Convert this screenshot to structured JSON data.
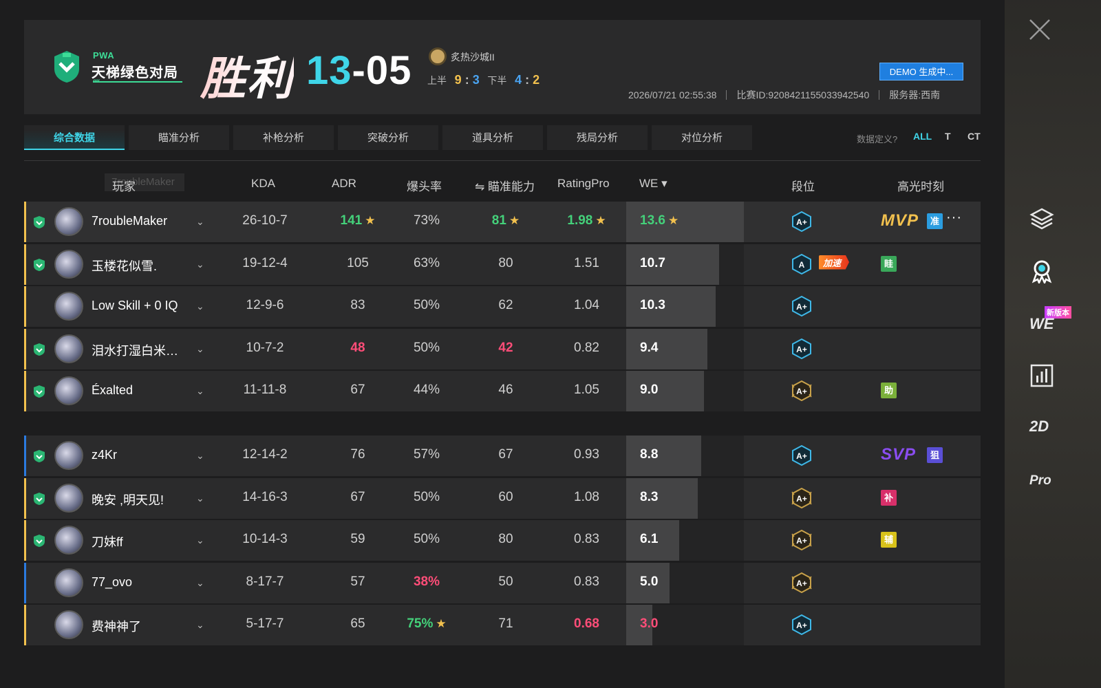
{
  "header": {
    "mode_tag": "PWA",
    "mode_title": "天梯绿色对局",
    "result": "胜利",
    "score_team": "13",
    "score_sep": "-",
    "score_enemy": "05",
    "map": "炙热沙城II",
    "first_half_label": "上半",
    "first_half_a": "9",
    "first_half_b": "3",
    "second_half_label": "下半",
    "second_half_a": "4",
    "second_half_b": "2",
    "half_sep": ":",
    "demo_button": "DEMO 生成中...",
    "datetime": "2026/07/21 02:55:38",
    "match_id": "比赛ID:9208421155033942540",
    "server": "服务器:西南"
  },
  "tabs": [
    {
      "label": "综合数据",
      "active": true
    },
    {
      "label": "瞄准分析"
    },
    {
      "label": "补枪分析"
    },
    {
      "label": "突破分析"
    },
    {
      "label": "道具分析"
    },
    {
      "label": "残局分析"
    },
    {
      "label": "对位分析"
    }
  ],
  "filters": {
    "data_definition": "数据定义?",
    "all": "ALL",
    "t": "T",
    "ct": "CT"
  },
  "table_headers": {
    "player": "玩家",
    "ghost_name": "7roubleMaker",
    "kda": "KDA",
    "adr": "ADR",
    "hs": "爆头率",
    "aim": "⇋ 瞄准能力",
    "rating": "RatingPro",
    "we": "WE ▾",
    "rank": "段位",
    "highlight": "高光时刻"
  },
  "team1": [
    {
      "name": "7roubleMaker",
      "kda": "26-10-7",
      "adr": "141",
      "hs": "73%",
      "aim": "81",
      "rating": "1.98",
      "we": "13.6",
      "we_fraction": 1.0,
      "green": true,
      "star_adr": true,
      "star_aim": true,
      "star_rating": true,
      "star_we": true,
      "rank": "A+",
      "highlight": "MVP",
      "badge": "准",
      "badge_color": "#2b9de0",
      "more": "···"
    },
    {
      "name": "玉楼花似雪.",
      "kda": "19-12-4",
      "adr": "105",
      "hs": "63%",
      "aim": "80",
      "rating": "1.51",
      "we": "10.7",
      "we_fraction": 0.79,
      "green": true,
      "rank": "A",
      "boost": "加速",
      "badge": "眭",
      "badge_color": "#3aa85a"
    },
    {
      "name": "Low Skill + 0 IQ",
      "kda": "12-9-6",
      "adr": "83",
      "hs": "50%",
      "aim": "62",
      "rating": "1.04",
      "we": "10.3",
      "we_fraction": 0.76,
      "green": false,
      "rank": "A+"
    },
    {
      "name": "泪水打湿白米饭...",
      "kda": "10-7-2",
      "adr": "48",
      "hs": "50%",
      "aim": "42",
      "rating": "0.82",
      "we": "9.4",
      "we_fraction": 0.69,
      "green": true,
      "red_adr": true,
      "red_aim": true,
      "rank": "A+"
    },
    {
      "name": "Éxalted",
      "kda": "11-11-8",
      "adr": "67",
      "hs": "44%",
      "aim": "46",
      "rating": "1.05",
      "we": "9.0",
      "we_fraction": 0.66,
      "green": true,
      "rank": "A+",
      "gold_rank": true,
      "badge": "助",
      "badge_color": "#7bb03a"
    }
  ],
  "team2": [
    {
      "name": "z4Kr",
      "kda": "12-14-2",
      "adr": "76",
      "hs": "57%",
      "aim": "67",
      "rating": "0.93",
      "we": "8.8",
      "we_fraction": 0.64,
      "green": true,
      "rank": "A+",
      "highlight": "SVP",
      "badge": "狙",
      "badge_color": "#5a4fd6",
      "stripe": "#2b7be0"
    },
    {
      "name": "晚安 ,明天见!",
      "kda": "14-16-3",
      "adr": "67",
      "hs": "50%",
      "aim": "60",
      "rating": "1.08",
      "we": "8.3",
      "we_fraction": 0.61,
      "green": true,
      "rank": "A+",
      "gold_rank": true,
      "badge": "补",
      "badge_color": "#d8306a"
    },
    {
      "name": "刀妹ff",
      "kda": "10-14-3",
      "adr": "59",
      "hs": "50%",
      "aim": "80",
      "rating": "0.83",
      "we": "6.1",
      "we_fraction": 0.45,
      "green": true,
      "rank": "A+",
      "gold_rank": true,
      "badge": "辅",
      "badge_color": "#d8c21a"
    },
    {
      "name": "77_ovo",
      "kda": "8-17-7",
      "adr": "57",
      "hs": "38%",
      "aim": "50",
      "rating": "0.83",
      "we": "5.0",
      "we_fraction": 0.37,
      "green": false,
      "red_hs": true,
      "rank": "A+",
      "gold_rank": true,
      "stripe": "#2b7be0"
    },
    {
      "name": "费神神了",
      "kda": "5-17-7",
      "adr": "65",
      "hs": "75%",
      "aim": "71",
      "rating": "0.68",
      "we": "3.0",
      "we_fraction": 0.22,
      "green": false,
      "green_hs": true,
      "star_hs": true,
      "red_rating": true,
      "red_we": true,
      "rank": "A+"
    }
  ],
  "rail": {
    "we": "WE",
    "new_version": "新版本",
    "two_d": "2D",
    "pro": "Pro"
  },
  "colors": {
    "accent": "#3fd5e8",
    "green": "#44d17a",
    "red": "#ff4d78",
    "gold": "#f2c14e",
    "stripe_team": "#f2c14e"
  }
}
